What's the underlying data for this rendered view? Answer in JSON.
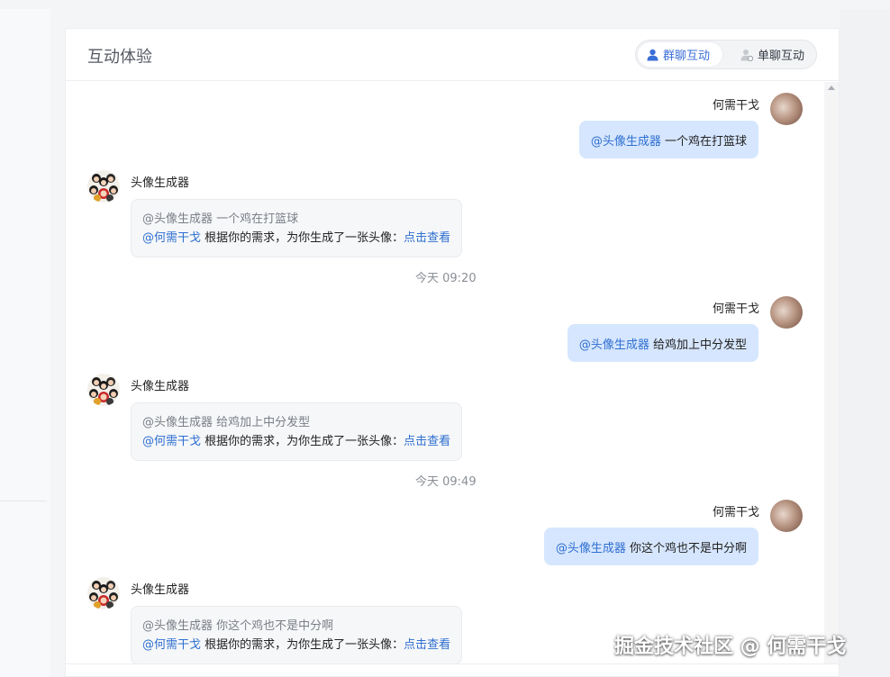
{
  "header": {
    "title": "互动体验",
    "tabs": [
      {
        "label": "群聊互动",
        "active": true
      },
      {
        "label": "单聊互动",
        "active": false
      }
    ]
  },
  "messages": [
    {
      "user": {
        "name": "何需干戈",
        "mention": "@头像生成器",
        "text": "一个鸡在打篮球"
      },
      "bot": {
        "name": "头像生成器",
        "quote": "@头像生成器 一个鸡在打篮球",
        "mention": "@何需干戈",
        "reply": "根据你的需求，为你生成了一张头像：",
        "link": "点击查看"
      },
      "time": "今天 09:20"
    },
    {
      "user": {
        "name": "何需干戈",
        "mention": "@头像生成器",
        "text": "给鸡加上中分发型"
      },
      "bot": {
        "name": "头像生成器",
        "quote": "@头像生成器 给鸡加上中分发型",
        "mention": "@何需干戈",
        "reply": "根据你的需求，为你生成了一张头像：",
        "link": "点击查看"
      },
      "time": "今天 09:49"
    },
    {
      "user": {
        "name": "何需干戈",
        "mention": "@头像生成器",
        "text": "你这个鸡也不是中分啊"
      },
      "bot": {
        "name": "头像生成器",
        "quote": "@头像生成器 你这个鸡也不是中分啊",
        "mention": "@何需干戈",
        "reply": "根据你的需求，为你生成了一张头像：",
        "link": "点击查看"
      },
      "time": ""
    }
  ],
  "watermark": "掘金技术社区 @ 何需干戈",
  "colors": {
    "accent": "#2e6fd0",
    "user_bubble": "#d6e6fe",
    "bot_bubble": "#f6f7f9"
  }
}
